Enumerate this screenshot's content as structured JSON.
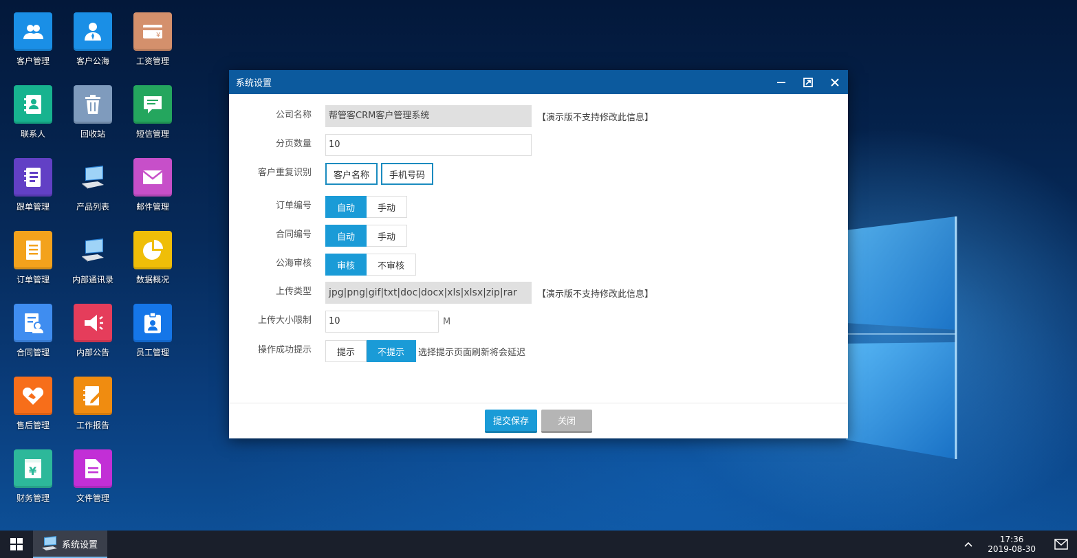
{
  "desktop": {
    "icons": [
      {
        "label": "客户管理",
        "icon": "users-icon",
        "color": "#1a8fe6"
      },
      {
        "label": "客户公海",
        "icon": "user-tie-icon",
        "color": "#1a8fe6"
      },
      {
        "label": "工资管理",
        "icon": "salary-card-icon",
        "color": "#d4906c"
      },
      {
        "label": "联系人",
        "icon": "contact-book-icon",
        "color": "#17b38f"
      },
      {
        "label": "回收站",
        "icon": "trash-icon",
        "color": "#7f9bbd"
      },
      {
        "label": "短信管理",
        "icon": "sms-icon",
        "color": "#24a65e"
      },
      {
        "label": "跟单管理",
        "icon": "notebook-icon",
        "color": "#6240c5"
      },
      {
        "label": "产品列表",
        "icon": "computer-icon",
        "color": "none"
      },
      {
        "label": "邮件管理",
        "icon": "mail-icon",
        "color": "#c74fc9"
      },
      {
        "label": "订单管理",
        "icon": "document-icon",
        "color": "#f3a21c"
      },
      {
        "label": "内部通讯录",
        "icon": "computer-icon",
        "color": "none"
      },
      {
        "label": "数据概况",
        "icon": "pie-chart-icon",
        "color": "#efbe08"
      },
      {
        "label": "合同管理",
        "icon": "contract-icon",
        "color": "#3f8df0"
      },
      {
        "label": "内部公告",
        "icon": "megaphone-icon",
        "color": "#e53d5b"
      },
      {
        "label": "员工管理",
        "icon": "id-badge-icon",
        "color": "#1576e8"
      },
      {
        "label": "售后管理",
        "icon": "handshake-icon",
        "color": "#f76e1a"
      },
      {
        "label": "工作报告",
        "icon": "report-edit-icon",
        "color": "#f08c10"
      },
      {
        "label": "财务管理",
        "icon": "finance-icon",
        "color": "#2db89a"
      },
      {
        "label": "文件管理",
        "icon": "file-icon",
        "color": "#c22fd6"
      }
    ]
  },
  "dialog": {
    "title": "系统设置",
    "fields": {
      "company_name": {
        "label": "公司名称",
        "value": "帮管客CRM客户管理系统",
        "note": "【演示版不支持修改此信息】"
      },
      "page_size": {
        "label": "分页数量",
        "value": "10"
      },
      "dup_check": {
        "label": "客户重复识别",
        "options": [
          "客户名称",
          "手机号码"
        ]
      },
      "order_no": {
        "label": "订单编号",
        "options": [
          "自动",
          "手动"
        ],
        "selected": "自动"
      },
      "contract_no": {
        "label": "合同编号",
        "options": [
          "自动",
          "手动"
        ],
        "selected": "自动"
      },
      "pool_review": {
        "label": "公海审核",
        "options": [
          "审核",
          "不审核"
        ],
        "selected": "审核"
      },
      "upload_types": {
        "label": "上传类型",
        "value": "jpg|png|gif|txt|doc|docx|xls|xlsx|zip|rar",
        "note": "【演示版不支持修改此信息】"
      },
      "upload_size": {
        "label": "上传大小限制",
        "value": "10",
        "unit": "M"
      },
      "success_tip": {
        "label": "操作成功提示",
        "options": [
          "提示",
          "不提示"
        ],
        "selected": "不提示",
        "note": "选择提示页面刷新将会延迟"
      }
    },
    "buttons": {
      "submit": "提交保存",
      "close": "关闭"
    }
  },
  "taskbar": {
    "task": "系统设置",
    "time": "17:36",
    "date": "2019-08-30"
  },
  "colors": {
    "accent": "#1a9bd7",
    "title_bar": "#0c5a9e",
    "taskbar": "#1a1f2b"
  }
}
